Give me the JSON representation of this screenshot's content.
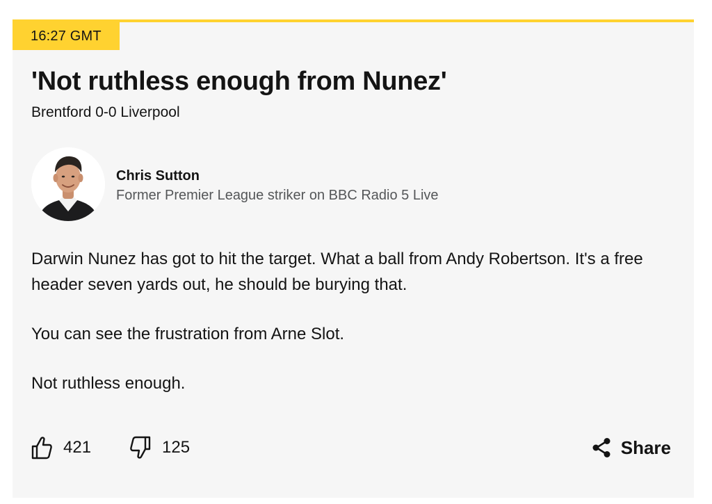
{
  "post": {
    "timestamp": "16:27 GMT",
    "headline": "'Not ruthless enough from Nunez'",
    "subheadline": "Brentford 0-0 Liverpool"
  },
  "contributor": {
    "name": "Chris Sutton",
    "role": "Former Premier League striker on BBC Radio 5 Live",
    "avatar_icon": "contributor-photo"
  },
  "body": {
    "paragraphs": [
      "Darwin Nunez has got to hit the target. What a ball from Andy Robertson. It's a free header seven yards out, he should be burying that.",
      "You can see the frustration from Arne Slot.",
      "Not ruthless enough."
    ]
  },
  "reactions": {
    "like_count": "421",
    "dislike_count": "125",
    "like_icon": "thumbs-up-icon",
    "dislike_icon": "thumbs-down-icon",
    "share_label": "Share",
    "share_icon": "share-icon"
  },
  "colors": {
    "accent": "#ffd230",
    "card_background": "#f6f6f6",
    "text": "#141414",
    "muted_text": "#545658"
  }
}
